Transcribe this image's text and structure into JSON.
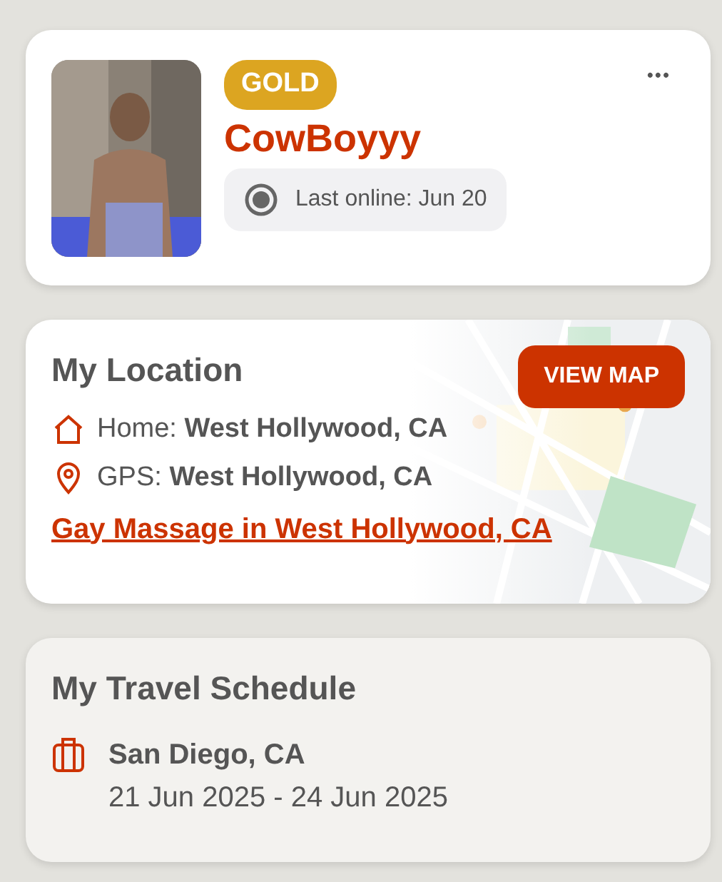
{
  "profile": {
    "badge": "GOLD",
    "name": "CowBoyyy",
    "status": "Last online: Jun 20",
    "menu": "•••"
  },
  "location": {
    "title": "My Location",
    "button": "VIEW MAP",
    "home_label": "Home:",
    "home": "West Hollywood, CA",
    "gps_label": "GPS:",
    "gps": "West Hollywood, CA",
    "link": "Gay Massage in West Hollywood, CA"
  },
  "travel": {
    "title": "My Travel Schedule",
    "trips": [
      {
        "place": "San Diego, CA",
        "dates": "21 Jun 2025 - 24 Jun 2025"
      }
    ]
  }
}
